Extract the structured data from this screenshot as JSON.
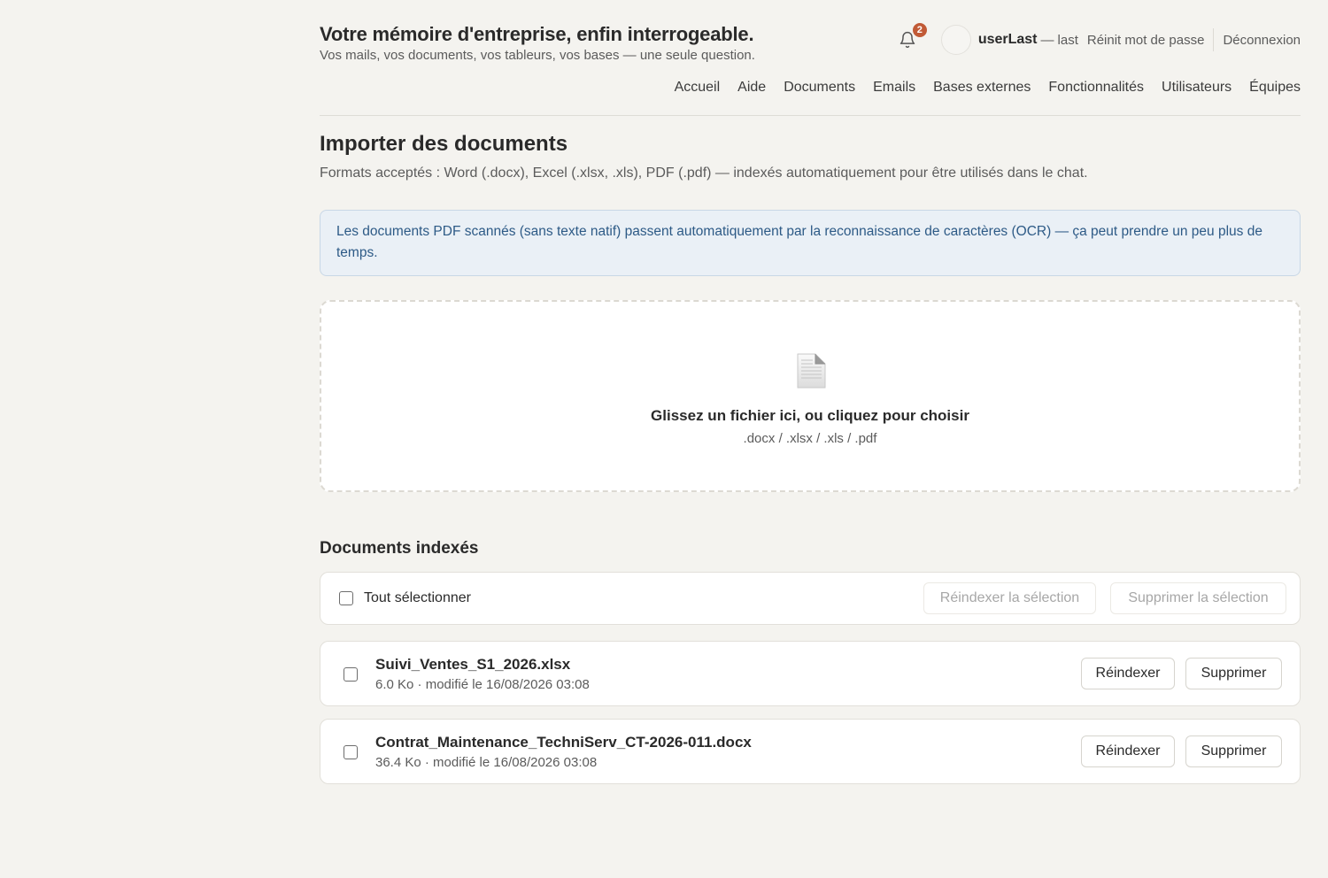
{
  "header": {
    "title": "Votre mémoire d'entreprise, enfin interrogeable.",
    "subtitle": "Vos mails, vos documents, vos tableurs, vos bases — une seule question."
  },
  "userbar": {
    "notification_count": "2",
    "username": "userLast",
    "dash": "—",
    "role": "last",
    "reset_password": "Réinit mot de passe",
    "logout": "Déconnexion"
  },
  "nav": {
    "items": [
      {
        "label": "Accueil"
      },
      {
        "label": "Aide"
      },
      {
        "label": "Documents"
      },
      {
        "label": "Emails"
      },
      {
        "label": "Bases externes"
      },
      {
        "label": "Fonctionnalités"
      },
      {
        "label": "Utilisateurs"
      },
      {
        "label": "Équipes"
      }
    ]
  },
  "import": {
    "title": "Importer des documents",
    "description": "Formats acceptés : Word (.docx), Excel (.xlsx, .xls), PDF (.pdf) — indexés automatiquement pour être utilisés dans le chat.",
    "info": "Les documents PDF scannés (sans texte natif) passent automatiquement par la reconnaissance de caractères (OCR) — ça peut prendre un peu plus de temps.",
    "dropzone_title": "Glissez un fichier ici, ou cliquez pour choisir",
    "dropzone_formats": ".docx / .xlsx / .xls / .pdf"
  },
  "documents": {
    "title": "Documents indexés",
    "select_all": "Tout sélectionner",
    "reindex_selection": "Réindexer la sélection",
    "delete_selection": "Supprimer la sélection",
    "reindex_label": "Réindexer",
    "delete_label": "Supprimer",
    "items": [
      {
        "name": "Suivi_Ventes_S1_2026.xlsx",
        "meta": "6.0 Ko · modifié le 16/08/2026 03:08"
      },
      {
        "name": "Contrat_Maintenance_TechniServ_CT-2026-011.docx",
        "meta": "36.4 Ko · modifié le 16/08/2026 03:08"
      }
    ]
  },
  "colors": {
    "background": "#f4f3ef",
    "badge": "#c15a36",
    "info_bg": "#eaf0f6",
    "info_text": "#2d5a86"
  }
}
